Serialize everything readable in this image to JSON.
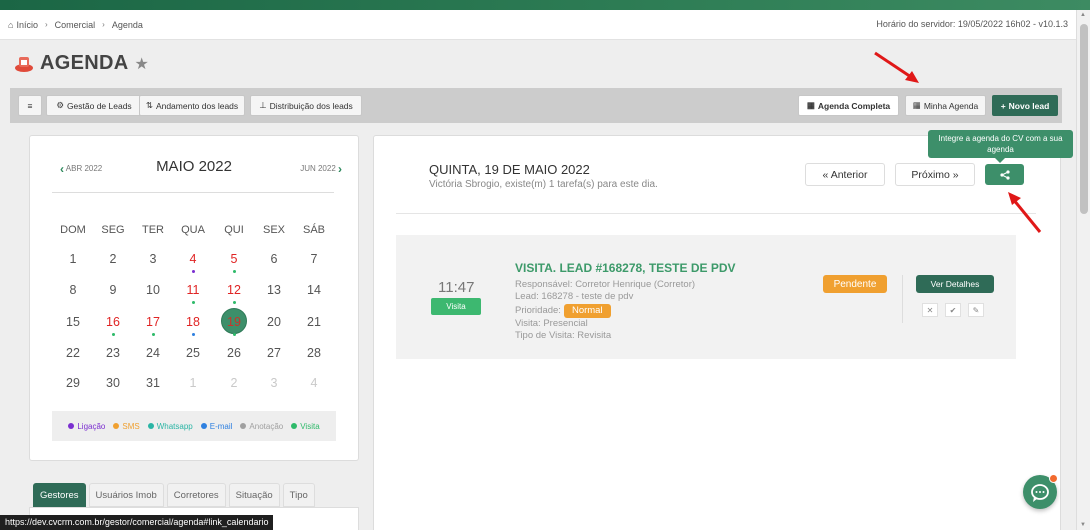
{
  "breadcrumb": {
    "home": "Início",
    "section": "Comercial",
    "page": "Agenda"
  },
  "server_time": "Horário do servidor: 19/05/2022 16h02 - v10.1.3",
  "page_title": "AGENDA",
  "toolbar": {
    "menu_label": "≡",
    "gestao": "Gestão de Leads",
    "andamento": "Andamento dos leads",
    "distribuicao": "Distribuição dos leads",
    "agenda_completa": "Agenda Completa",
    "minha_agenda": "Minha Agenda",
    "novo_lead": "Novo lead"
  },
  "calendar": {
    "month": "MAIO 2022",
    "prev": "ABR 2022",
    "next": "JUN 2022",
    "weekdays": [
      "DOM",
      "SEG",
      "TER",
      "QUA",
      "QUI",
      "SEX",
      "SÁB"
    ],
    "weeks": [
      [
        "1",
        "2",
        "3",
        "4",
        "5",
        "6",
        "7"
      ],
      [
        "8",
        "9",
        "10",
        "11",
        "12",
        "13",
        "14"
      ],
      [
        "15",
        "16",
        "17",
        "18",
        "19",
        "20",
        "21"
      ],
      [
        "22",
        "23",
        "24",
        "25",
        "26",
        "27",
        "28"
      ],
      [
        "29",
        "30",
        "31",
        "1",
        "2",
        "3",
        "4"
      ]
    ],
    "selected_day": "19"
  },
  "legend": {
    "ligacao": {
      "label": "Ligação",
      "color": "#7b2fd0"
    },
    "sms": {
      "label": "SMS",
      "color": "#f0a030"
    },
    "whatsapp": {
      "label": "Whatsapp",
      "color": "#2ab5a5"
    },
    "email": {
      "label": "E-mail",
      "color": "#2f80e0"
    },
    "anotacao": {
      "label": "Anotação",
      "color": "#a0a0a0"
    },
    "visita": {
      "label": "Visita",
      "color": "#2fba6a"
    }
  },
  "tabs": [
    "Gestores",
    "Usuários Imob",
    "Corretores",
    "Situação",
    "Tipo"
  ],
  "day_panel": {
    "heading": "QUINTA, 19 DE MAIO 2022",
    "subtitle": "Victória Sbrogio, existe(m) 1 tarefa(s) para este dia.",
    "prev_label": "« Anterior",
    "next_label": "Próximo »",
    "share_tooltip": "Integre a agenda do CV com a sua agenda"
  },
  "task": {
    "time": "11:47",
    "type_badge": "Visita",
    "title": "VISITA. LEAD #168278, TESTE DE PDV",
    "responsavel": "Responsável: Corretor Henrique (Corretor)",
    "lead": "Lead: 168278 - teste de pdv",
    "prioridade_label": "Prioridade:",
    "prioridade": "Normal",
    "visita": "Visita: Presencial",
    "tipo_visita": "Tipo de Visita: Revisita",
    "status": "Pendente",
    "details_button": "Ver Detalhes"
  },
  "status_url": "https://dev.cvcrm.com.br/gestor/comercial/agenda#link_calendario",
  "colors": {
    "brand": "#2f6b57",
    "accent": "#3d8f6a",
    "pending": "#f0a030",
    "alert": "#e02424"
  }
}
